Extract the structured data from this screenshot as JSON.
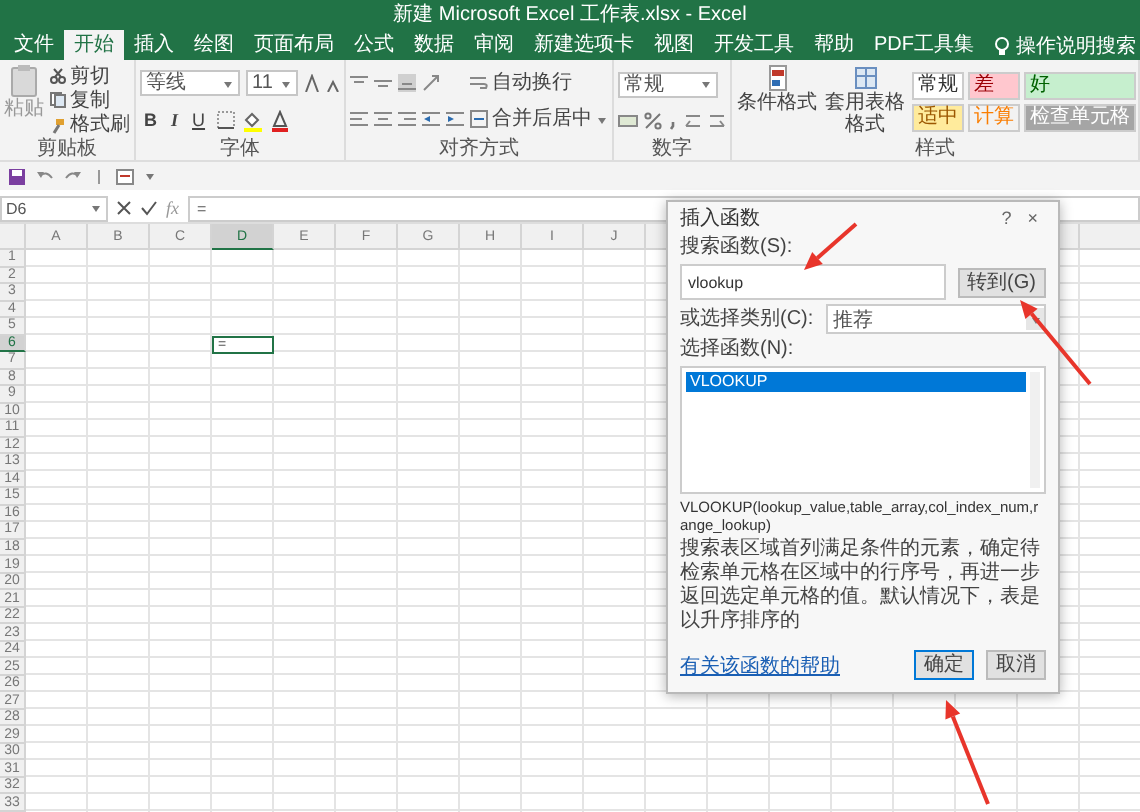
{
  "window": {
    "title": "新建 Microsoft Excel 工作表.xlsx  -  Excel"
  },
  "tabs": [
    {
      "label": "文件",
      "selected": false
    },
    {
      "label": "开始",
      "selected": true
    },
    {
      "label": "插入",
      "selected": false
    },
    {
      "label": "绘图",
      "selected": false
    },
    {
      "label": "页面布局",
      "selected": false
    },
    {
      "label": "公式",
      "selected": false
    },
    {
      "label": "数据",
      "selected": false
    },
    {
      "label": "审阅",
      "selected": false
    },
    {
      "label": "新建选项卡",
      "selected": false
    },
    {
      "label": "视图",
      "selected": false
    },
    {
      "label": "开发工具",
      "selected": false
    },
    {
      "label": "帮助",
      "selected": false
    },
    {
      "label": "PDF工具集",
      "selected": false
    }
  ],
  "tell_me": "操作说明搜索",
  "clipboard": {
    "title": "剪贴板",
    "paste": "粘贴",
    "items": [
      {
        "kind": "cut",
        "label": "剪切"
      },
      {
        "kind": "copy",
        "label": "复制"
      },
      {
        "kind": "painter",
        "label": "格式刷"
      }
    ]
  },
  "font": {
    "title": "字体",
    "name": "等线",
    "size": "11",
    "format_buttons": [
      "B",
      "I",
      "U"
    ]
  },
  "alignment": {
    "title": "对齐方式",
    "wrap": "自动换行",
    "merge": "合并后居中"
  },
  "number": {
    "title": "数字",
    "format": "常规"
  },
  "styles": {
    "title": "样式",
    "conditional": "条件格式",
    "table": "套用表格格式",
    "gallery": [
      {
        "kind": "normal",
        "label": "常规"
      },
      {
        "kind": "bad",
        "label": "差"
      },
      {
        "kind": "good",
        "label": "好"
      },
      {
        "kind": "neutral",
        "label": "适中"
      },
      {
        "kind": "calculation",
        "label": "计算"
      },
      {
        "kind": "check",
        "label": "检查单元格"
      }
    ]
  },
  "formula_bar": {
    "name_box": "D6",
    "function_button": "fx",
    "formula": "="
  },
  "sheet": {
    "columns": [
      {
        "label": "A",
        "selected": false
      },
      {
        "label": "B",
        "selected": false
      },
      {
        "label": "C",
        "selected": false
      },
      {
        "label": "D",
        "selected": true
      },
      {
        "label": "E",
        "selected": false
      },
      {
        "label": "F",
        "selected": false
      },
      {
        "label": "G",
        "selected": false
      },
      {
        "label": "H",
        "selected": false
      },
      {
        "label": "I",
        "selected": false
      },
      {
        "label": "J",
        "selected": false
      }
    ],
    "rows": [
      {
        "label": "1",
        "selected": false
      },
      {
        "label": "2",
        "selected": false
      },
      {
        "label": "3",
        "selected": false
      },
      {
        "label": "4",
        "selected": false
      },
      {
        "label": "5",
        "selected": false
      },
      {
        "label": "6",
        "selected": true
      },
      {
        "label": "7",
        "selected": false
      },
      {
        "label": "8",
        "selected": false
      },
      {
        "label": "9",
        "selected": false
      },
      {
        "label": "10",
        "selected": false
      },
      {
        "label": "11",
        "selected": false
      },
      {
        "label": "12",
        "selected": false
      },
      {
        "label": "13",
        "selected": false
      },
      {
        "label": "14",
        "selected": false
      },
      {
        "label": "15",
        "selected": false
      },
      {
        "label": "16",
        "selected": false
      },
      {
        "label": "17",
        "selected": false
      },
      {
        "label": "18",
        "selected": false
      },
      {
        "label": "19",
        "selected": false
      },
      {
        "label": "20",
        "selected": false
      },
      {
        "label": "21",
        "selected": false
      },
      {
        "label": "22",
        "selected": false
      },
      {
        "label": "23",
        "selected": false
      },
      {
        "label": "24",
        "selected": false
      },
      {
        "label": "25",
        "selected": false
      },
      {
        "label": "26",
        "selected": false
      },
      {
        "label": "27",
        "selected": false
      },
      {
        "label": "28",
        "selected": false
      },
      {
        "label": "29",
        "selected": false
      },
      {
        "label": "30",
        "selected": false
      },
      {
        "label": "31",
        "selected": false
      },
      {
        "label": "32",
        "selected": false
      },
      {
        "label": "33",
        "selected": false
      }
    ],
    "active_cell": {
      "value": "="
    }
  },
  "dialog": {
    "title": "插入函数",
    "help": "?",
    "close": "×",
    "search_label": "搜索函数(S):",
    "search_value": "vlookup",
    "go_button": "转到(G)",
    "category_label": "或选择类别(C):",
    "category_value": "推荐",
    "list_label": "选择函数(N):",
    "functions": [
      {
        "label": "VLOOKUP",
        "selected": true
      }
    ],
    "syntax": "VLOOKUP(lookup_value,table_array,col_index_num,range_lookup)",
    "description": "搜索表区域首列满足条件的元素，确定待检索单元格在区域中的行序号，再进一步返回选定单元格的值。默认情况下，表是以升序排序的",
    "help_link": "有关该函数的帮助",
    "ok_button": "确定",
    "cancel_button": "取消"
  },
  "annotations": [
    {
      "kind": "arrow"
    },
    {
      "kind": "arrow"
    },
    {
      "kind": "arrow"
    }
  ]
}
